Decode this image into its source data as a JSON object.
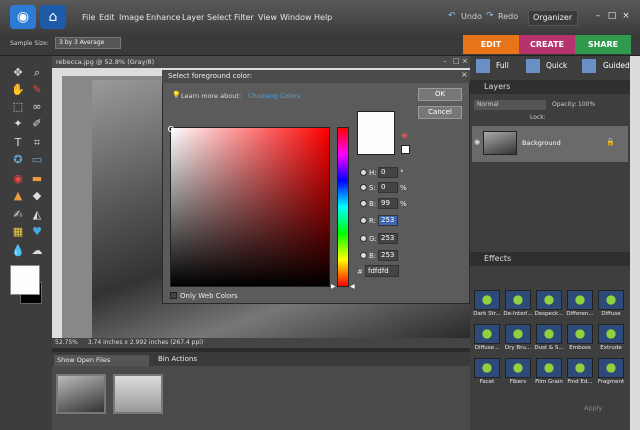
{
  "menu": [
    "File",
    "Edit",
    "Image",
    "Enhance",
    "Layer",
    "Select",
    "Filter",
    "View",
    "Window",
    "Help"
  ],
  "toolbar": {
    "undo": "Undo",
    "redo": "Redo",
    "organizer": "Organizer"
  },
  "options": {
    "sample_size_label": "Sample Size:",
    "sample_size_value": "3 by 3 Average"
  },
  "modes": [
    "EDIT",
    "CREATE",
    "SHARE"
  ],
  "document": {
    "title": "rebecca.jpg @ 52.8% (Gray/8)",
    "zoom": "52.75%",
    "dimensions": "3.74 inches x 2.992 inches (267.4 ppi)"
  },
  "bin": {
    "show_files": "Show Open Files",
    "bin_actions": "Bin Actions"
  },
  "right_tabs": [
    "Full",
    "Quick",
    "Guided"
  ],
  "layers": {
    "header": "Layers",
    "blend": "Normal",
    "opacity_label": "Opacity:",
    "opacity_value": "100%",
    "lock_label": "Lock:",
    "layer_name": "Background"
  },
  "effects": {
    "header": "Effects",
    "items": [
      "Dark Str...",
      "De-Interl...",
      "Despeck...",
      "Differen...",
      "Diffuse",
      "Diffuse...",
      "Dry Bru...",
      "Dust & S...",
      "Emboss",
      "Extrude",
      "Facet",
      "Fibers",
      "Film Grain",
      "Find Ed...",
      "Fragment"
    ],
    "apply": "Apply"
  },
  "dialog": {
    "title": "Select foreground color:",
    "learn_label": "Learn more about:",
    "learn_link": "Choosing Colors",
    "ok": "OK",
    "cancel": "Cancel",
    "fields": [
      {
        "label": "H:",
        "value": "0",
        "unit": "°"
      },
      {
        "label": "S:",
        "value": "0",
        "unit": "%"
      },
      {
        "label": "B:",
        "value": "99",
        "unit": "%"
      },
      {
        "label": "R:",
        "value": "253",
        "unit": ""
      },
      {
        "label": "G:",
        "value": "253",
        "unit": ""
      },
      {
        "label": "B:",
        "value": "253",
        "unit": ""
      }
    ],
    "hex_label": "#",
    "hex": "fdfdfd",
    "web_only": "Only Web Colors",
    "selected_color": "#fdfdfd"
  }
}
